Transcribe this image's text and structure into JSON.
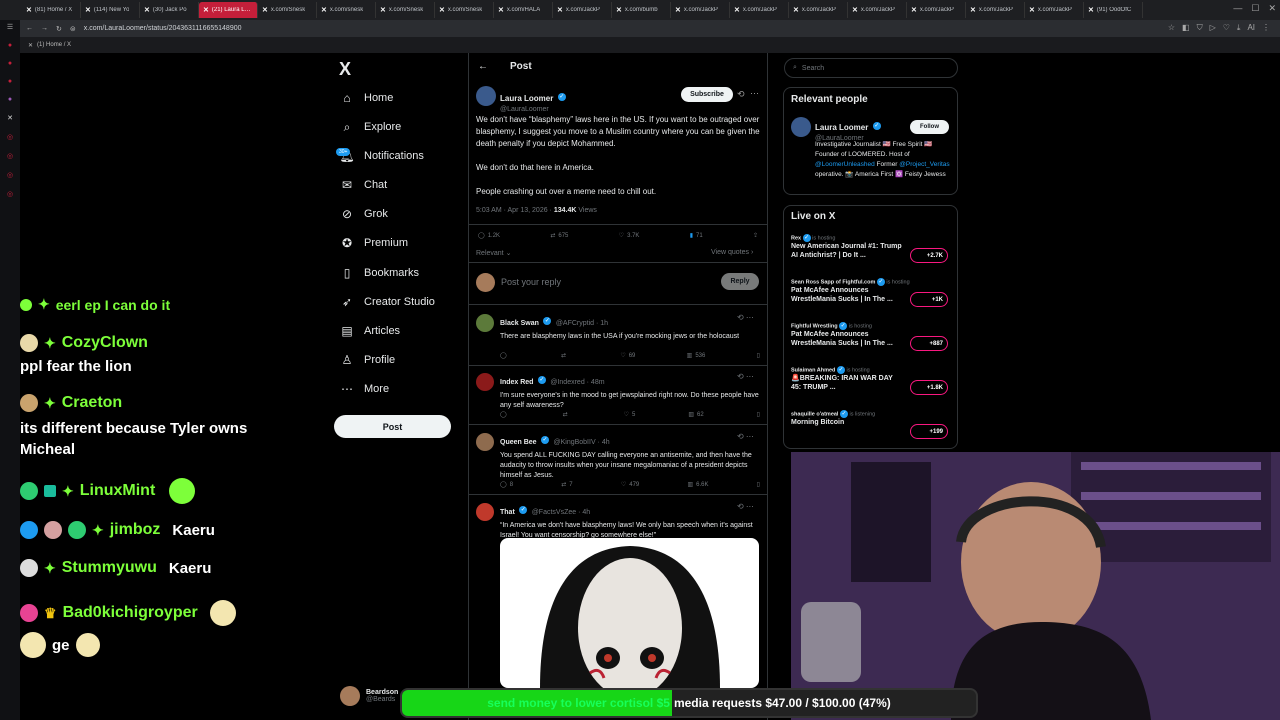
{
  "browser": {
    "tabs": [
      {
        "label": "(81) Home / X",
        "active": false
      },
      {
        "label": "(114) New Yo",
        "active": false
      },
      {
        "label": "(30) Jack Po",
        "active": false
      },
      {
        "label": "(21) Laura Loomer on X",
        "active": true
      },
      {
        "label": "x.com/Snesk",
        "active": false
      },
      {
        "label": "x.com/snesk",
        "active": false
      },
      {
        "label": "x.com/Snesk",
        "active": false
      },
      {
        "label": "x.com/Snesk",
        "active": false
      },
      {
        "label": "x.com/HALA",
        "active": false
      },
      {
        "label": "x.com/JackP",
        "active": false
      },
      {
        "label": "x.com/bumb",
        "active": false
      },
      {
        "label": "x.com/JackP",
        "active": false
      },
      {
        "label": "x.com/JackP",
        "active": false
      },
      {
        "label": "x.com/JackP",
        "active": false
      },
      {
        "label": "x.com/JackP",
        "active": false
      },
      {
        "label": "x.com/JackP",
        "active": false
      },
      {
        "label": "x.com/JackP",
        "active": false
      },
      {
        "label": "x.com/JackP",
        "active": false
      },
      {
        "label": "(91) OodOfC",
        "active": false
      }
    ],
    "url": "x.com/LauraLoomer/status/2043631116655148900",
    "bookmark": "(1) Home / X",
    "accent": "#c41f3a"
  },
  "chat": {
    "partial_top": "eerl ep I can do it",
    "messages": [
      {
        "name": "CozyClown",
        "text": "ppl fear the lion"
      },
      {
        "name": "Craeton",
        "text": "its different because Tyler owns Micheal"
      },
      {
        "name": "LinuxMint",
        "text": ""
      },
      {
        "name": "jimboz",
        "text": "Kaeru"
      },
      {
        "name": "Stummyuwu",
        "text": "Kaeru"
      },
      {
        "name": "Bad0kichigroyper",
        "text": ""
      },
      {
        "name": "",
        "text": "ge"
      }
    ]
  },
  "nav": {
    "logo": "X",
    "items": [
      {
        "label": "Home",
        "icon": "home-icon"
      },
      {
        "label": "Explore",
        "icon": "search-icon"
      },
      {
        "label": "Notifications",
        "icon": "bell-icon"
      },
      {
        "label": "Chat",
        "icon": "chat-icon"
      },
      {
        "label": "Grok",
        "icon": "grok-icon"
      },
      {
        "label": "Premium",
        "icon": "premium-icon"
      },
      {
        "label": "Bookmarks",
        "icon": "bookmark-icon"
      },
      {
        "label": "Creator Studio",
        "icon": "rocket-icon"
      },
      {
        "label": "Articles",
        "icon": "articles-icon"
      },
      {
        "label": "Profile",
        "icon": "person-icon"
      },
      {
        "label": "More",
        "icon": "more-icon"
      }
    ],
    "notifications_badge": "30+",
    "post_button": "Post",
    "account_name": "Beardson",
    "account_handle": "@Beards"
  },
  "post": {
    "header": "Post",
    "author": "Laura Loomer",
    "handle": "@LauraLoomer",
    "subscribe": "Subscribe",
    "body1": "We don't have “blasphemy” laws here in the US. If you want to be outraged over blasphemy, I suggest you move to a Muslim country where you can be given the death penalty if you depict Mohammed.",
    "body2": "We don't do that here in America.",
    "body3": "People crashing out over a meme need to chill out.",
    "time": "5:03 AM · Apr 13, 2026 ·",
    "views": "134.4K",
    "views_label": "Views",
    "replies": "1.2K",
    "reposts": "675",
    "likes": "3.7K",
    "bookmarks": "71",
    "sort": "Relevant",
    "view_quotes": "View quotes",
    "reply_placeholder": "Post your reply",
    "reply_button": "Reply"
  },
  "replies": [
    {
      "name": "Black Swan",
      "handle": "@AFCryptid · 1h",
      "text": "There are blasphemy laws in the USA if you're mocking jews or the holocaust",
      "replies": "",
      "reposts": "",
      "likes": "69",
      "views": "536"
    },
    {
      "name": "Index Red",
      "handle": "@Indexred · 48m",
      "text": "I'm sure everyone's in the mood to get jewsplained right now. Do these people have any self awareness?",
      "replies": "",
      "reposts": "",
      "likes": "5",
      "views": "62"
    },
    {
      "name": "Queen Bee",
      "handle": "@KingBobIIV · 4h",
      "text": "You spend ALL FUCKING DAY calling everyone an antisemite, and then have the audacity to throw insults when your insane megalomaniac of a president depicts himself as Jesus.",
      "replies": "8",
      "reposts": "7",
      "likes": "479",
      "views": "6.6K"
    },
    {
      "name": "That",
      "handle": "@FactsVsZee · 4h",
      "text": "“In America we don't have blasphemy laws! We only ban speech when it's against Israel! You want censorship? go somewhere else!”",
      "replies": "",
      "reposts": "",
      "likes": "",
      "views": ""
    }
  ],
  "right": {
    "search_placeholder": "Search",
    "relevant_title": "Relevant people",
    "person_name": "Laura Loomer",
    "person_handle": "@LauraLoomer",
    "follow": "Follow",
    "bio_pre": "Investigative Journalist 🇺🇸 Free Spirit 🇺🇸Founder of LOOMERED. Host of",
    "bio_link1": "@LoomerUnleashed",
    "bio_mid": "Former",
    "bio_link2": "@Project_Veritas",
    "bio_post": "operative. 📸 America First 🔯 Feisty Jewess",
    "live_title": "Live on X",
    "spaces": [
      {
        "host": "Rex",
        "status": "is hosting",
        "title": "New American Journal #1: Trump AI Antichrist? | Do It ...",
        "count": "+2.7K"
      },
      {
        "host": "Sean Ross Sapp of Fightful.com",
        "status": "is hosting",
        "title": "Pat McAfee Announces WrestleMania Sucks | In The ...",
        "count": "+1K"
      },
      {
        "host": "Fightful Wrestling",
        "status": "is hosting",
        "title": "Pat McAfee Announces WrestleMania Sucks | In The ...",
        "count": "+887"
      },
      {
        "host": "Sulaiman Ahmed",
        "status": "is hosting",
        "title": "🚨BREAKING: IRAN WAR DAY 45: TRUMP ...",
        "count": "+1.8K"
      },
      {
        "host": "shaquille o'atmeal",
        "status": "is listening",
        "title": "Morning Bitcoin",
        "count": "+199"
      }
    ]
  },
  "donation": {
    "send_text": "send money to lower cortisol $5",
    "media_text": "media requests $47.00 / $100.00 (47%)",
    "progress": 0.47
  }
}
